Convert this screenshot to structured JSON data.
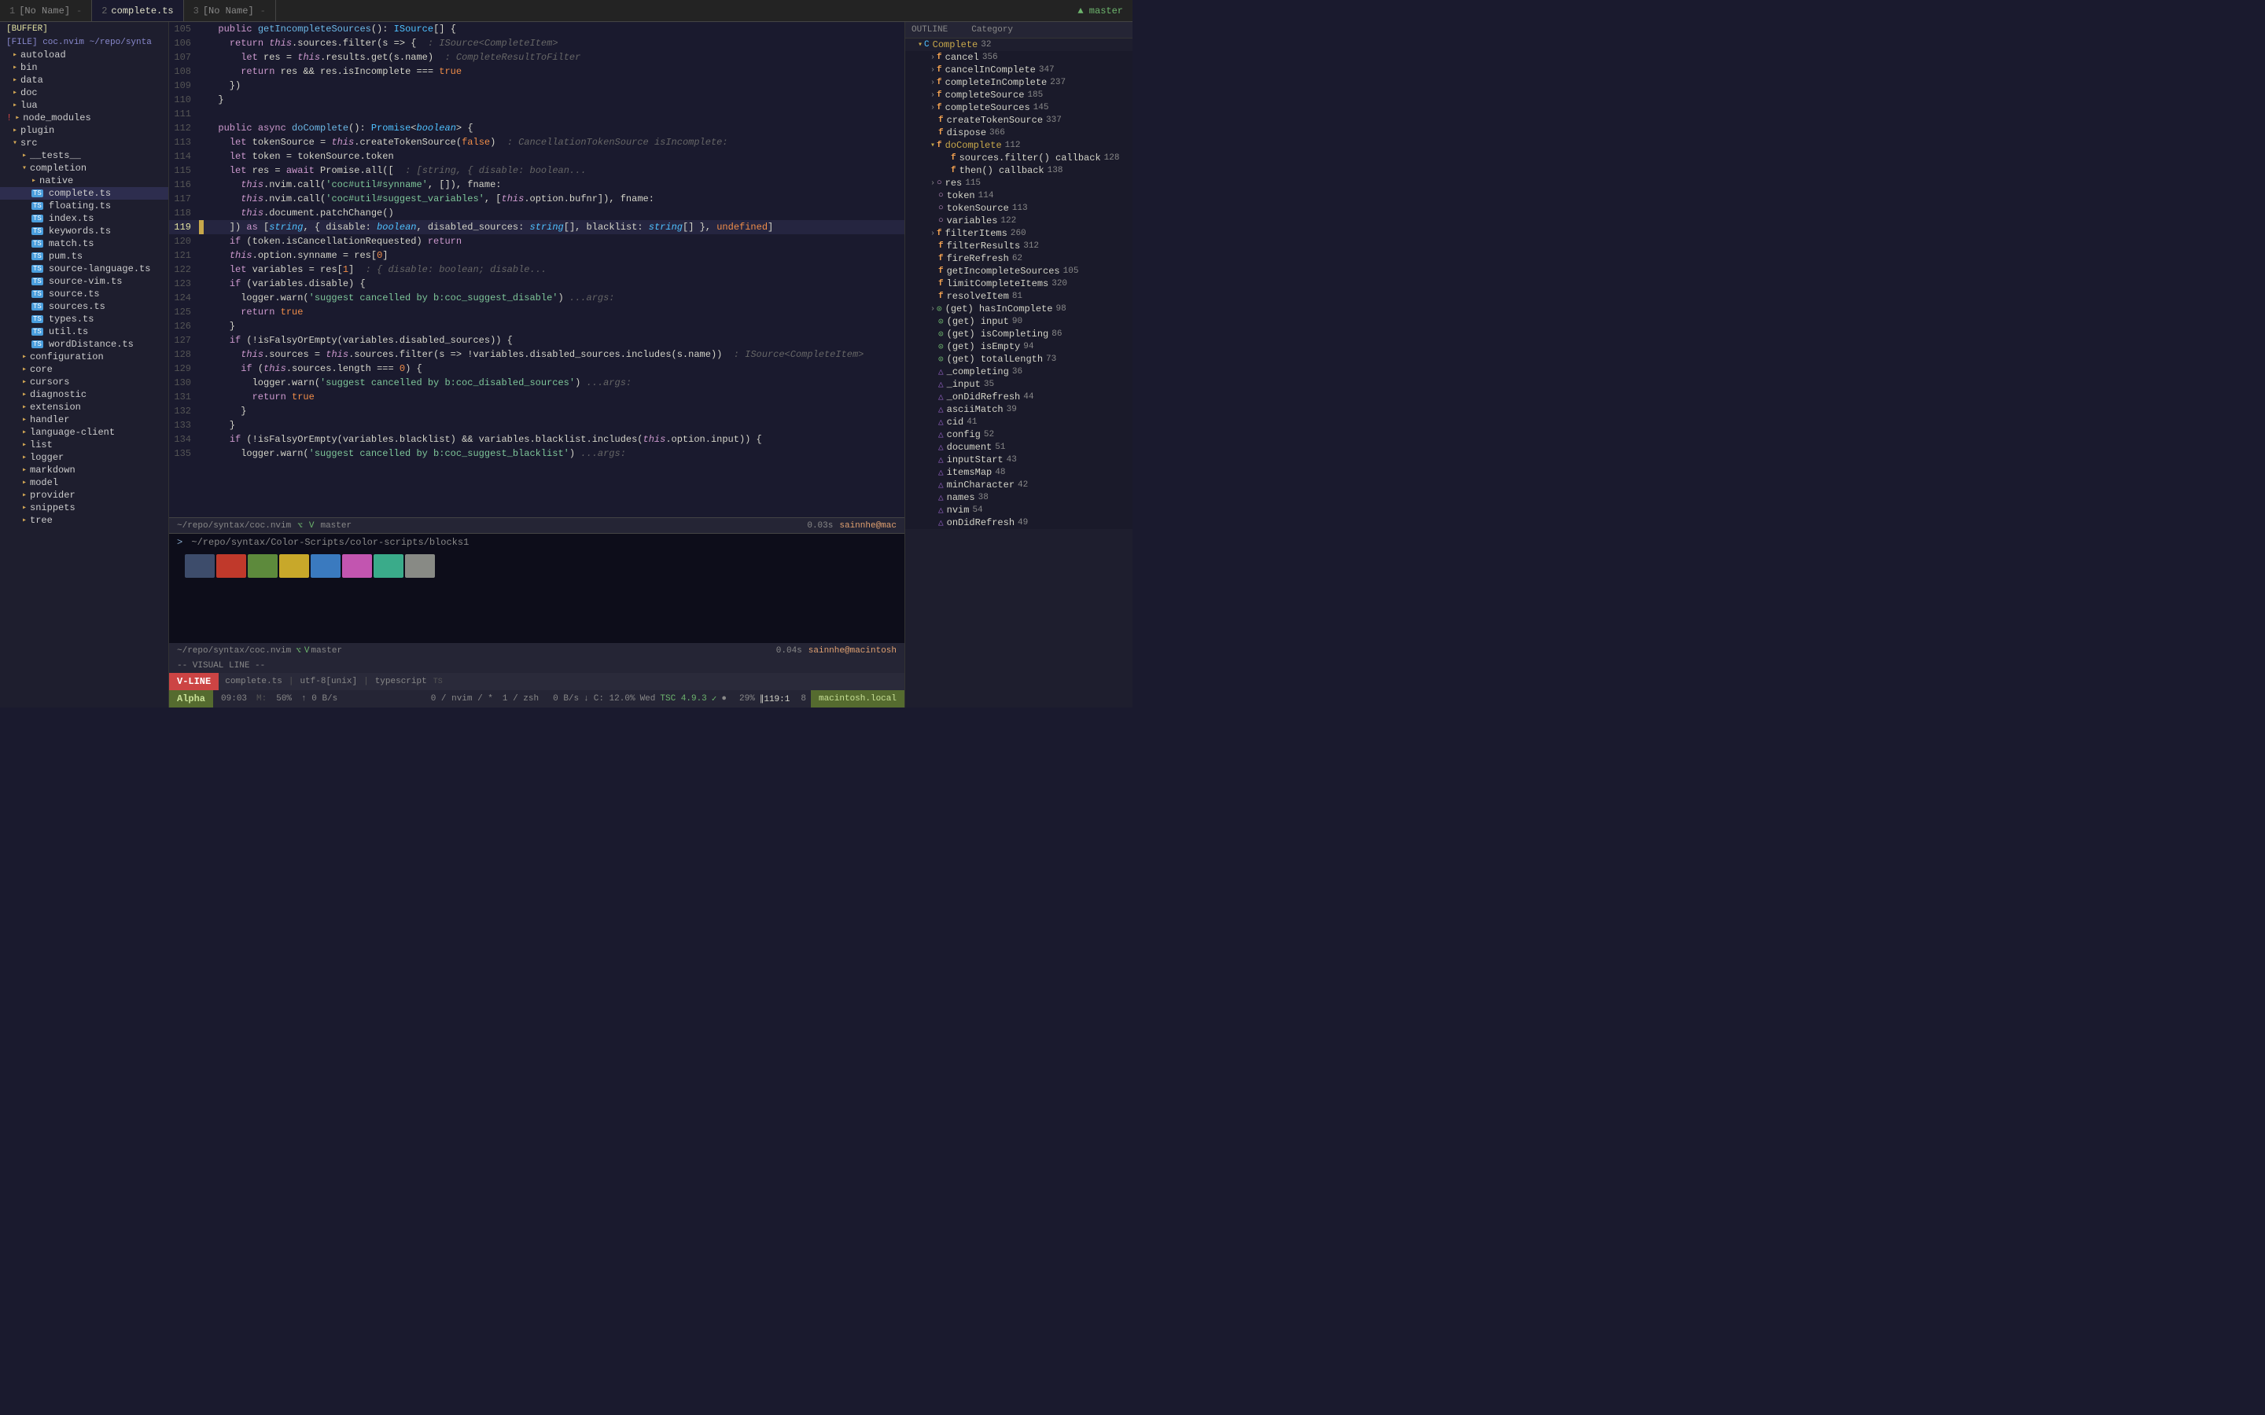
{
  "tabs": [
    {
      "num": "1",
      "name": "[No Name]",
      "active": false,
      "modified": false
    },
    {
      "num": "2",
      "name": "complete.ts",
      "active": true,
      "modified": false
    },
    {
      "num": "3",
      "name": "[No Name]",
      "active": false,
      "modified": false
    }
  ],
  "git_branch": "master",
  "sidebar": {
    "buffer_label": "[BUFFER]",
    "file_label": "[FILE] coc.nvim ~/repo/synta",
    "items": [
      {
        "indent": 1,
        "icon": "folder",
        "name": "autoload"
      },
      {
        "indent": 1,
        "icon": "folder",
        "name": "bin"
      },
      {
        "indent": 1,
        "icon": "folder",
        "name": "data"
      },
      {
        "indent": 1,
        "icon": "folder",
        "name": "doc"
      },
      {
        "indent": 1,
        "icon": "folder",
        "name": "lua"
      },
      {
        "indent": 1,
        "icon": "folder",
        "name": "node_modules",
        "excl": true
      },
      {
        "indent": 1,
        "icon": "folder",
        "name": "plugin"
      },
      {
        "indent": 1,
        "icon": "folder",
        "name": "src",
        "open": true
      },
      {
        "indent": 2,
        "icon": "folder",
        "name": "__tests__"
      },
      {
        "indent": 2,
        "icon": "folder",
        "name": "completion",
        "open": true
      },
      {
        "indent": 3,
        "icon": "folder",
        "name": "native"
      },
      {
        "indent": 3,
        "icon": "ts",
        "name": "complete.ts",
        "active": true
      },
      {
        "indent": 3,
        "icon": "ts",
        "name": "floating.ts"
      },
      {
        "indent": 3,
        "icon": "ts",
        "name": "index.ts"
      },
      {
        "indent": 3,
        "icon": "ts",
        "name": "keywords.ts"
      },
      {
        "indent": 3,
        "icon": "ts",
        "name": "match.ts"
      },
      {
        "indent": 3,
        "icon": "ts",
        "name": "pum.ts"
      },
      {
        "indent": 3,
        "icon": "ts",
        "name": "source-language.ts"
      },
      {
        "indent": 3,
        "icon": "ts",
        "name": "source-vim.ts"
      },
      {
        "indent": 3,
        "icon": "ts",
        "name": "source.ts"
      },
      {
        "indent": 3,
        "icon": "ts",
        "name": "sources.ts"
      },
      {
        "indent": 3,
        "icon": "ts",
        "name": "types.ts"
      },
      {
        "indent": 3,
        "icon": "ts",
        "name": "util.ts"
      },
      {
        "indent": 3,
        "icon": "ts",
        "name": "wordDistance.ts"
      },
      {
        "indent": 2,
        "icon": "folder",
        "name": "configuration"
      },
      {
        "indent": 2,
        "icon": "folder",
        "name": "core"
      },
      {
        "indent": 2,
        "icon": "folder",
        "name": "cursors"
      },
      {
        "indent": 2,
        "icon": "folder",
        "name": "diagnostic"
      },
      {
        "indent": 2,
        "icon": "folder",
        "name": "extension"
      },
      {
        "indent": 2,
        "icon": "folder",
        "name": "handler"
      },
      {
        "indent": 2,
        "icon": "folder",
        "name": "language-client"
      },
      {
        "indent": 2,
        "icon": "folder",
        "name": "list"
      },
      {
        "indent": 2,
        "icon": "folder",
        "name": "logger"
      },
      {
        "indent": 2,
        "icon": "folder",
        "name": "markdown"
      },
      {
        "indent": 2,
        "icon": "folder",
        "name": "model"
      },
      {
        "indent": 2,
        "icon": "folder",
        "name": "provider"
      },
      {
        "indent": 2,
        "icon": "folder",
        "name": "snippets"
      },
      {
        "indent": 2,
        "icon": "folder",
        "name": "tree"
      }
    ]
  },
  "code_lines": [
    {
      "num": 105,
      "code": "  public getIncompleteSources(): ISource[] {",
      "modified": false
    },
    {
      "num": 106,
      "code": "    return this.sources.filter(s => {  : ISource<CompleteItem>",
      "modified": false
    },
    {
      "num": 107,
      "code": "      let res = this.results.get(s.name)  : CompleteResultToFilter",
      "modified": false
    },
    {
      "num": 108,
      "code": "      return res && res.isIncomplete === true",
      "modified": false
    },
    {
      "num": 109,
      "code": "    })",
      "modified": false
    },
    {
      "num": 110,
      "code": "  }",
      "modified": false
    },
    {
      "num": 111,
      "code": "",
      "modified": false
    },
    {
      "num": 112,
      "code": "  public async doComplete(): Promise<boolean> {",
      "modified": false
    },
    {
      "num": 113,
      "code": "    let tokenSource = this.createTokenSource(false)  : CancellationTokenSource isIncomplete:",
      "modified": false
    },
    {
      "num": 114,
      "code": "    let token = tokenSource.token",
      "modified": false
    },
    {
      "num": 115,
      "code": "    let res = await Promise.all([  : [string, { disable: boolean...",
      "modified": false
    },
    {
      "num": 116,
      "code": "      this.nvim.call('coc#util#synname', []), fname:",
      "modified": false
    },
    {
      "num": 117,
      "code": "      this.nvim.call('coc#util#suggest_variables', [this.option.bufnr]), fname:",
      "modified": false
    },
    {
      "num": 118,
      "code": "      this.document.patchChange()",
      "modified": false
    },
    {
      "num": 119,
      "code": "    ]) as [string, { disable: boolean, disabled_sources: string[], blacklist: string[] }, undefined]",
      "modified": true,
      "active": true
    },
    {
      "num": 120,
      "code": "    if (token.isCancellationRequested) return",
      "modified": false
    },
    {
      "num": 121,
      "code": "    this.option.synname = res[0]",
      "modified": false
    },
    {
      "num": 122,
      "code": "    let variables = res[1]  : { disable: boolean; disable...",
      "modified": false
    },
    {
      "num": 123,
      "code": "    if (variables.disable) {",
      "modified": false
    },
    {
      "num": 124,
      "code": "      logger.warn('suggest cancelled by b:coc_suggest_disable') ...args:",
      "modified": false
    },
    {
      "num": 125,
      "code": "      return true",
      "modified": false
    },
    {
      "num": 126,
      "code": "    }",
      "modified": false
    },
    {
      "num": 127,
      "code": "    if (!isFalsyOrEmpty(variables.disabled_sources)) {",
      "modified": false
    },
    {
      "num": 128,
      "code": "      this.sources = this.sources.filter(s => !variables.disabled_sources.includes(s.name))  : ISource<CompleteItem>",
      "modified": false
    },
    {
      "num": 129,
      "code": "      if (this.sources.length === 0) {",
      "modified": false
    },
    {
      "num": 130,
      "code": "        logger.warn('suggest cancelled by b:coc_disabled_sources') ...args:",
      "modified": false
    },
    {
      "num": 131,
      "code": "        return true",
      "modified": false
    },
    {
      "num": 132,
      "code": "      }",
      "modified": false
    },
    {
      "num": 133,
      "code": "    }",
      "modified": false
    },
    {
      "num": 134,
      "code": "    if (!isFalsyOrEmpty(variables.blacklist) && variables.blacklist.includes(this.option.input)) {",
      "modified": false
    },
    {
      "num": 135,
      "code": "      logger.warn('suggest cancelled by b:coc_suggest_blacklist') ...args:",
      "modified": false
    }
  ],
  "status_code": {
    "path": "~/repo/syntax/coc.nvim",
    "git_icon": "⌥",
    "branch_icon": "V",
    "branch": "master",
    "time": "0.03s",
    "user": "sainnhe@mac"
  },
  "terminal": {
    "prompt1": ">",
    "path1": "~/repo/syntax/Color-Scripts/color-scripts/blocks1",
    "colors": [
      "#3d4c6b",
      "#c0392b",
      "#5d8a3c",
      "#c8a82a",
      "#3a7abf",
      "#c255b0",
      "#3aab8a",
      "#888a85"
    ],
    "path_git": "~/repo/syntax/coc.nvim",
    "branch2": "master",
    "time2": "0.04s",
    "user2": "sainnhe@macintosh"
  },
  "outline": {
    "title": "OUTLINE",
    "category": "Category",
    "items": [
      {
        "level": 0,
        "expanded": true,
        "type": "class",
        "name": "Complete",
        "num": "32"
      },
      {
        "level": 1,
        "expanded": false,
        "type": "func",
        "name": "cancel",
        "num": "356"
      },
      {
        "level": 1,
        "expanded": false,
        "type": "func",
        "name": "cancelInComplete",
        "num": "347"
      },
      {
        "level": 1,
        "expanded": false,
        "type": "func",
        "name": "completeInComplete",
        "num": "237"
      },
      {
        "level": 1,
        "expanded": false,
        "type": "func",
        "name": "completeSource",
        "num": "185"
      },
      {
        "level": 1,
        "expanded": false,
        "type": "func",
        "name": "completeSources",
        "num": "145"
      },
      {
        "level": 1,
        "expanded": false,
        "type": "func",
        "name": "createTokenSource",
        "num": "337"
      },
      {
        "level": 1,
        "expanded": false,
        "type": "func",
        "name": "dispose",
        "num": "366"
      },
      {
        "level": 1,
        "expanded": true,
        "type": "func",
        "name": "doComplete",
        "num": "112"
      },
      {
        "level": 2,
        "expanded": false,
        "type": "func",
        "name": "sources.filter() callback",
        "num": "128"
      },
      {
        "level": 2,
        "expanded": false,
        "type": "func",
        "name": "then() callback",
        "num": "138"
      },
      {
        "level": 1,
        "expanded": false,
        "type": "var",
        "name": "res",
        "num": "115"
      },
      {
        "level": 2,
        "type": "var",
        "name": "token",
        "num": "114"
      },
      {
        "level": 2,
        "type": "var",
        "name": "tokenSource",
        "num": "113"
      },
      {
        "level": 2,
        "type": "var",
        "name": "variables",
        "num": "122"
      },
      {
        "level": 1,
        "expanded": false,
        "type": "func",
        "name": "filterItems",
        "num": "260"
      },
      {
        "level": 1,
        "expanded": false,
        "type": "func",
        "name": "filterResults",
        "num": "312"
      },
      {
        "level": 1,
        "expanded": false,
        "type": "func",
        "name": "fireRefresh",
        "num": "62"
      },
      {
        "level": 1,
        "expanded": false,
        "type": "func",
        "name": "getIncompleteSources",
        "num": "105"
      },
      {
        "level": 1,
        "expanded": false,
        "type": "func",
        "name": "limitCompleteItems",
        "num": "320"
      },
      {
        "level": 1,
        "expanded": false,
        "type": "func",
        "name": "resolveItem",
        "num": "81"
      },
      {
        "level": 1,
        "expanded": false,
        "type": "prop",
        "name": "(get) hasInComplete",
        "num": "98"
      },
      {
        "level": 1,
        "expanded": false,
        "type": "prop",
        "name": "(get) input",
        "num": "90"
      },
      {
        "level": 1,
        "expanded": false,
        "type": "prop",
        "name": "(get) isCompleting",
        "num": "86"
      },
      {
        "level": 1,
        "expanded": false,
        "type": "prop",
        "name": "(get) isEmpty",
        "num": "94"
      },
      {
        "level": 1,
        "expanded": false,
        "type": "prop",
        "name": "(get) totalLength",
        "num": "73"
      },
      {
        "level": 1,
        "expanded": false,
        "type": "var2",
        "name": "_completing",
        "num": "36"
      },
      {
        "level": 1,
        "expanded": false,
        "type": "var2",
        "name": "_input",
        "num": "35"
      },
      {
        "level": 1,
        "expanded": false,
        "type": "var2",
        "name": "_onDidRefresh",
        "num": "44"
      },
      {
        "level": 1,
        "expanded": false,
        "type": "var2",
        "name": "asciiMatch",
        "num": "39"
      },
      {
        "level": 1,
        "expanded": false,
        "type": "var2",
        "name": "cid",
        "num": "41"
      },
      {
        "level": 1,
        "expanded": false,
        "type": "var2",
        "name": "config",
        "num": "52"
      },
      {
        "level": 1,
        "expanded": false,
        "type": "var2",
        "name": "document",
        "num": "51"
      },
      {
        "level": 1,
        "expanded": false,
        "type": "var2",
        "name": "inputStart",
        "num": "43"
      },
      {
        "level": 1,
        "expanded": false,
        "type": "var2",
        "name": "itemsMap",
        "num": "48"
      },
      {
        "level": 1,
        "expanded": false,
        "type": "var2",
        "name": "minCharacter",
        "num": "42"
      },
      {
        "level": 1,
        "expanded": false,
        "type": "var2",
        "name": "names",
        "num": "38"
      },
      {
        "level": 1,
        "expanded": false,
        "type": "var2",
        "name": "nvim",
        "num": "54"
      },
      {
        "level": 1,
        "expanded": false,
        "type": "var2",
        "name": "onDidRefresh",
        "num": "49"
      }
    ]
  },
  "statusbar": {
    "mode": "V-LINE",
    "file": "complete.ts",
    "encoding": "utf-8[unix]",
    "filetype": "typescript",
    "tsc_version": "TSC 4.9.3",
    "percent": "29%",
    "position": "119:1",
    "col": "8",
    "alpha": "Alpha",
    "time": "09:03",
    "mixed": "M: 50%",
    "upload": "↑ 0 B/s",
    "nvim_procs": "0 / nvim / *",
    "zsh_procs": "1 / zsh",
    "net_down": "0 B/s",
    "net_up": "↓",
    "cpu": "C: 12.0%",
    "day": "Wed",
    "hostname": "macintosh.local",
    "visual_line": "-- VISUAL LINE --"
  }
}
